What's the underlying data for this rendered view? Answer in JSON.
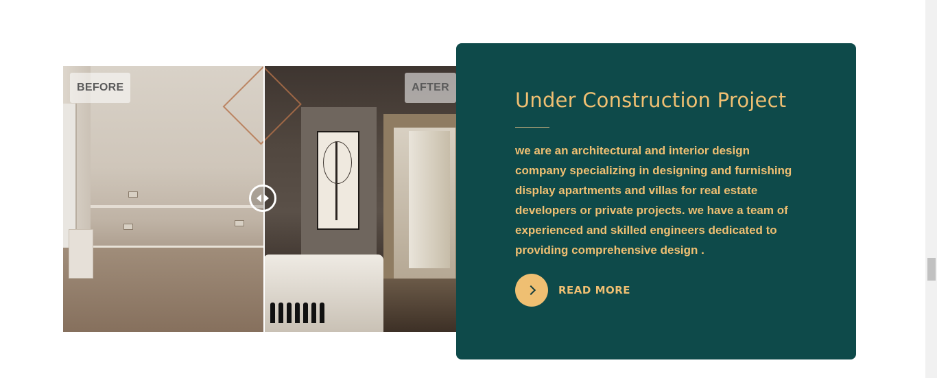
{
  "compare": {
    "before_label": "BEFORE",
    "after_label": "AFTER",
    "handle_icon": "drag-left-right-icon"
  },
  "card": {
    "title": "Under Construction Project",
    "description": "we are an architectural and interior design company specializing in designing and furnishing display apartments and villas for real estate developers or private projects. we have a team of experienced and skilled engineers dedicated to providing comprehensive design .",
    "read_more_label": "READ MORE",
    "read_more_icon": "chevron-right-icon"
  },
  "colors": {
    "card_bg": "#0e4a4a",
    "accent": "#efbf72",
    "page_bg": "#ffffff"
  }
}
